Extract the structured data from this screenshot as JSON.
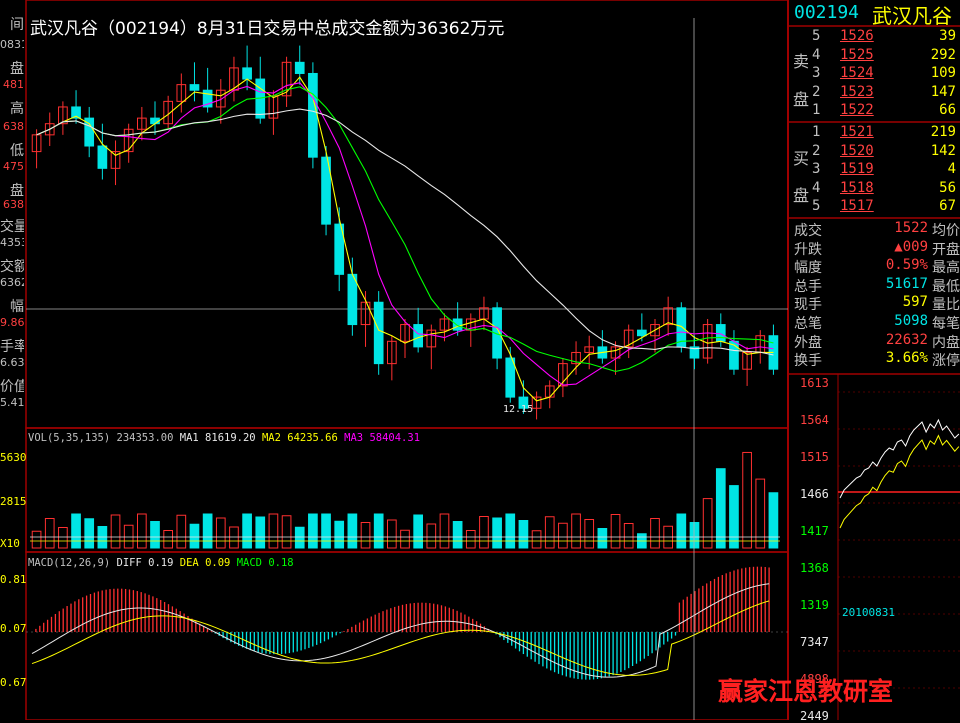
{
  "page_title": "武汉凡谷（002194）8月31日交易中总成交金额为36362万元",
  "left_labels": [
    "间",
    "0831",
    "盘",
    "481",
    "高",
    "638",
    "低",
    "475",
    "盘",
    "638",
    "交量",
    "4353",
    "交额",
    "6362",
    "幅",
    "9.86",
    "手率",
    "6.63",
    "价值",
    "5.41"
  ],
  "indicators": {
    "vol_title": "VOL(5,35,135)",
    "vol_value": "234353.00",
    "ma1_label": "MA1",
    "ma1_value": "81619.20",
    "ma2_label": "MA2",
    "ma2_value": "64235.66",
    "ma3_label": "MA3",
    "ma3_value": "58404.31",
    "macd_title": "MACD(12,26,9)",
    "diff_label": "DIFF",
    "diff_value": "0.19",
    "dea_label": "DEA",
    "dea_value": "0.09",
    "macd_label": "MACD",
    "macd_value": "0.18"
  },
  "vol_axis": [
    "5630",
    "2815",
    "X10"
  ],
  "macd_axis": [
    "0.81",
    "0.07",
    "0.67"
  ],
  "low_marker_label": "12.15",
  "right_panel": {
    "code": "002194",
    "name": "武汉凡谷",
    "sell_label_1": "卖",
    "sell_label_2": "盘",
    "buy_label_1": "买",
    "buy_label_2": "盘",
    "sell_orders": [
      {
        "level": "5",
        "price": "1526",
        "volume": "39"
      },
      {
        "level": "4",
        "price": "1525",
        "volume": "292"
      },
      {
        "level": "3",
        "price": "1524",
        "volume": "109"
      },
      {
        "level": "2",
        "price": "1523",
        "volume": "147"
      },
      {
        "level": "1",
        "price": "1522",
        "volume": "66"
      }
    ],
    "buy_orders": [
      {
        "level": "1",
        "price": "1521",
        "volume": "219"
      },
      {
        "level": "2",
        "price": "1520",
        "volume": "142"
      },
      {
        "level": "3",
        "price": "1519",
        "volume": "4"
      },
      {
        "level": "4",
        "price": "1518",
        "volume": "56"
      },
      {
        "level": "5",
        "price": "1517",
        "volume": "67"
      }
    ],
    "stats": [
      {
        "label": "成交",
        "value": "1522",
        "label2": "均价",
        "color": "#ff4040"
      },
      {
        "label": "升跌",
        "value": "▲009",
        "label2": "开盘",
        "color": "#ff4040"
      },
      {
        "label": "幅度",
        "value": "0.59%",
        "label2": "最高",
        "color": "#ff4040"
      },
      {
        "label": "总手",
        "value": "51617",
        "label2": "最低",
        "color": "#00e5e5"
      },
      {
        "label": "现手",
        "value": "597",
        "label2": "量比",
        "color": "#ffff00"
      },
      {
        "label": "总笔",
        "value": "5098",
        "label2": "每笔",
        "color": "#00e5e5"
      },
      {
        "label": "外盘",
        "value": "22632",
        "label2": "内盘",
        "color": "#ff4040"
      },
      {
        "label": "换手",
        "value": "3.66%",
        "label2": "涨停",
        "color": "#ffff00"
      }
    ],
    "mini_axis": [
      "1613",
      "1564",
      "1515",
      "1466",
      "1417",
      "1368",
      "1319",
      "7347",
      "4898",
      "2449"
    ],
    "mini_date": "20100831"
  },
  "watermark": "赢家江恩教研室",
  "colors": {
    "up": "#ff3030",
    "down": "#00e5e5",
    "ma_white": "#e8e8e8",
    "ma_yellow": "#ffff00",
    "ma_magenta": "#ff00ff",
    "ma_green": "#00ff00",
    "frame": "#a00000"
  },
  "chart_data": {
    "type": "line",
    "candles": [
      {
        "o": 1450,
        "h": 1490,
        "l": 1420,
        "c": 1480
      },
      {
        "o": 1480,
        "h": 1520,
        "l": 1460,
        "c": 1500
      },
      {
        "o": 1500,
        "h": 1540,
        "l": 1480,
        "c": 1530
      },
      {
        "o": 1530,
        "h": 1560,
        "l": 1500,
        "c": 1510
      },
      {
        "o": 1510,
        "h": 1530,
        "l": 1440,
        "c": 1460
      },
      {
        "o": 1460,
        "h": 1500,
        "l": 1400,
        "c": 1420
      },
      {
        "o": 1420,
        "h": 1470,
        "l": 1390,
        "c": 1450
      },
      {
        "o": 1450,
        "h": 1500,
        "l": 1430,
        "c": 1490
      },
      {
        "o": 1490,
        "h": 1530,
        "l": 1470,
        "c": 1510
      },
      {
        "o": 1510,
        "h": 1540,
        "l": 1480,
        "c": 1500
      },
      {
        "o": 1500,
        "h": 1550,
        "l": 1490,
        "c": 1540
      },
      {
        "o": 1540,
        "h": 1590,
        "l": 1520,
        "c": 1570
      },
      {
        "o": 1570,
        "h": 1610,
        "l": 1540,
        "c": 1560
      },
      {
        "o": 1560,
        "h": 1600,
        "l": 1520,
        "c": 1530
      },
      {
        "o": 1530,
        "h": 1580,
        "l": 1500,
        "c": 1560
      },
      {
        "o": 1560,
        "h": 1620,
        "l": 1540,
        "c": 1600
      },
      {
        "o": 1600,
        "h": 1640,
        "l": 1560,
        "c": 1580
      },
      {
        "o": 1580,
        "h": 1620,
        "l": 1500,
        "c": 1510
      },
      {
        "o": 1510,
        "h": 1560,
        "l": 1480,
        "c": 1550
      },
      {
        "o": 1550,
        "h": 1620,
        "l": 1530,
        "c": 1610
      },
      {
        "o": 1610,
        "h": 1640,
        "l": 1570,
        "c": 1590
      },
      {
        "o": 1590,
        "h": 1610,
        "l": 1420,
        "c": 1440
      },
      {
        "o": 1440,
        "h": 1460,
        "l": 1300,
        "c": 1320
      },
      {
        "o": 1320,
        "h": 1350,
        "l": 1200,
        "c": 1230
      },
      {
        "o": 1230,
        "h": 1260,
        "l": 1120,
        "c": 1140
      },
      {
        "o": 1140,
        "h": 1200,
        "l": 1100,
        "c": 1180
      },
      {
        "o": 1180,
        "h": 1200,
        "l": 1050,
        "c": 1070
      },
      {
        "o": 1070,
        "h": 1120,
        "l": 1040,
        "c": 1110
      },
      {
        "o": 1110,
        "h": 1150,
        "l": 1080,
        "c": 1140
      },
      {
        "o": 1140,
        "h": 1170,
        "l": 1090,
        "c": 1100
      },
      {
        "o": 1100,
        "h": 1140,
        "l": 1060,
        "c": 1130
      },
      {
        "o": 1130,
        "h": 1160,
        "l": 1110,
        "c": 1150
      },
      {
        "o": 1150,
        "h": 1180,
        "l": 1120,
        "c": 1130
      },
      {
        "o": 1130,
        "h": 1160,
        "l": 1100,
        "c": 1150
      },
      {
        "o": 1150,
        "h": 1190,
        "l": 1130,
        "c": 1170
      },
      {
        "o": 1170,
        "h": 1180,
        "l": 1060,
        "c": 1080
      },
      {
        "o": 1080,
        "h": 1100,
        "l": 1000,
        "c": 1010
      },
      {
        "o": 1010,
        "h": 1040,
        "l": 980,
        "c": 990
      },
      {
        "o": 990,
        "h": 1020,
        "l": 970,
        "c": 1010
      },
      {
        "o": 1010,
        "h": 1040,
        "l": 990,
        "c": 1030
      },
      {
        "o": 1030,
        "h": 1080,
        "l": 1010,
        "c": 1070
      },
      {
        "o": 1070,
        "h": 1110,
        "l": 1050,
        "c": 1090
      },
      {
        "o": 1090,
        "h": 1120,
        "l": 1060,
        "c": 1100
      },
      {
        "o": 1100,
        "h": 1130,
        "l": 1070,
        "c": 1080
      },
      {
        "o": 1080,
        "h": 1110,
        "l": 1050,
        "c": 1100
      },
      {
        "o": 1100,
        "h": 1140,
        "l": 1080,
        "c": 1130
      },
      {
        "o": 1130,
        "h": 1160,
        "l": 1110,
        "c": 1120
      },
      {
        "o": 1120,
        "h": 1150,
        "l": 1090,
        "c": 1140
      },
      {
        "o": 1140,
        "h": 1190,
        "l": 1120,
        "c": 1170
      },
      {
        "o": 1170,
        "h": 1180,
        "l": 1090,
        "c": 1100
      },
      {
        "o": 1100,
        "h": 1120,
        "l": 1060,
        "c": 1080
      },
      {
        "o": 1080,
        "h": 1150,
        "l": 1070,
        "c": 1140
      },
      {
        "o": 1140,
        "h": 1160,
        "l": 1100,
        "c": 1110
      },
      {
        "o": 1110,
        "h": 1130,
        "l": 1050,
        "c": 1060
      },
      {
        "o": 1060,
        "h": 1100,
        "l": 1030,
        "c": 1090
      },
      {
        "o": 1090,
        "h": 1130,
        "l": 1070,
        "c": 1120
      },
      {
        "o": 1120,
        "h": 1140,
        "l": 1050,
        "c": 1060
      }
    ]
  }
}
